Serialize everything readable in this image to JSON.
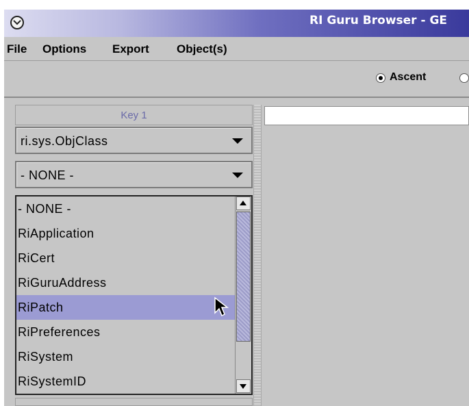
{
  "window": {
    "title": "RI Guru Browser - GE",
    "menu_icon": "window-menu-icon"
  },
  "menubar": {
    "items": [
      "File",
      "Options",
      "Export",
      "Object(s)"
    ]
  },
  "toolbar": {
    "sort_options": [
      {
        "label": "Ascent",
        "checked": true
      },
      {
        "label": "",
        "checked": false
      }
    ]
  },
  "left_panel": {
    "key_header": "Key 1",
    "class_combo": {
      "value": "ri.sys.ObjClass"
    },
    "object_combo": {
      "value": "- NONE -"
    },
    "dropdown_list": {
      "items": [
        "- NONE -",
        "RiApplication",
        "RiCert",
        "RiGuruAddress",
        "RiPatch",
        "RiPreferences",
        "RiSystem",
        "RiSystemID"
      ],
      "selected": "RiPatch"
    }
  },
  "colors": {
    "title_gradient_end": "#3a3a9c",
    "selection": "#9b9bd3",
    "key_header_text": "#6a6aa8"
  }
}
